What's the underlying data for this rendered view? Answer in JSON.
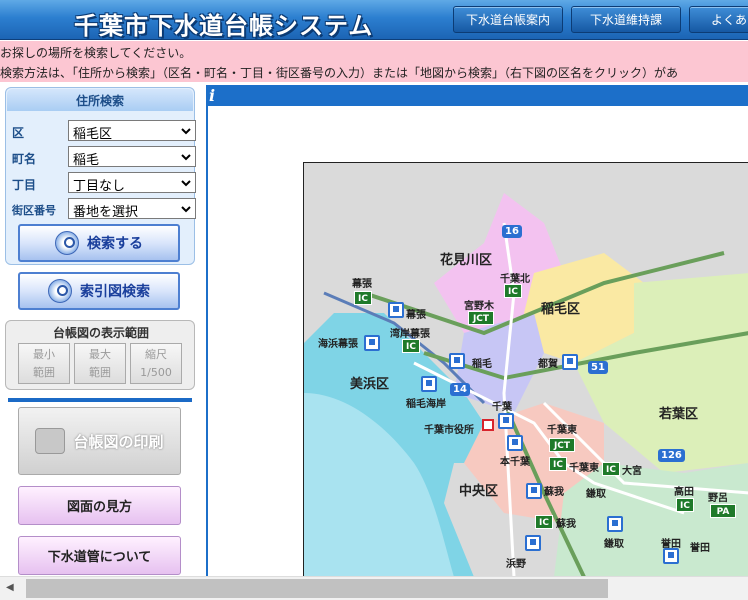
{
  "header": {
    "title": "千葉市下水道台帳システム",
    "nav": [
      "下水道台帳案内",
      "下水道維持課",
      "よくある"
    ]
  },
  "notice": {
    "line1": "お探しの場所を検索してください。",
    "line2": "検索方法は、「住所から検索」（区名・町名・丁目・街区番号の入力）または「地図から検索」（右下図の区名をクリック）があ"
  },
  "search": {
    "heading": "住所検索",
    "fields": [
      {
        "label": "区",
        "value": "稲毛区"
      },
      {
        "label": "町名",
        "value": "稲毛"
      },
      {
        "label": "丁目",
        "value": "丁目なし"
      },
      {
        "label": "街区番号",
        "value": "番地を選択"
      }
    ],
    "search_button": "検索する",
    "index_button": "索引図検索"
  },
  "range": {
    "title": "台帳図の表示範囲",
    "buttons": [
      {
        "line1": "最小",
        "line2": "範囲"
      },
      {
        "line1": "最大",
        "line2": "範囲"
      },
      {
        "line1": "縮尺",
        "line2": "1/500"
      }
    ]
  },
  "actions": {
    "print": "台帳図の印刷",
    "legend": "図面の見方",
    "about": "下水道管について"
  },
  "content": {
    "info_icon": "i"
  },
  "map": {
    "wards": {
      "hanamigawa": "花見川区",
      "inage": "稲毛区",
      "mihama": "美浜区",
      "wakaba": "若葉区",
      "chuo": "中央区"
    },
    "labels": {
      "makuhari_ic": "幕張",
      "makuhari_st": "幕張",
      "kaihin_makuhari": "海浜幕張",
      "wangan_makuhari": "湾岸幕張",
      "miyanogi": "宮野木",
      "chiba_kita": "千葉北",
      "inage_st": "稲毛",
      "tsuga": "都賀",
      "inage_kaigan": "稲毛海岸",
      "chiba_st": "千葉",
      "city_hall": "千葉市役所",
      "chiba_higashi_jct": "千葉東",
      "hon_chiba": "本千葉",
      "chiba_higashi_ic": "千葉東",
      "ohmiya": "大宮",
      "soga_st": "蘇我",
      "soga_ic": "蘇我",
      "kamatori": "鎌取",
      "kamatori_st": "鎌取",
      "takada": "高田",
      "nobe": "野呂",
      "hamano": "浜野",
      "honda": "誉田",
      "honda2": "誉田"
    },
    "badges": {
      "ic": "IC",
      "jct": "JCT",
      "pa": "PA"
    },
    "routes": {
      "r16": "16",
      "r14": "14",
      "r51": "51",
      "r126": "126"
    }
  }
}
